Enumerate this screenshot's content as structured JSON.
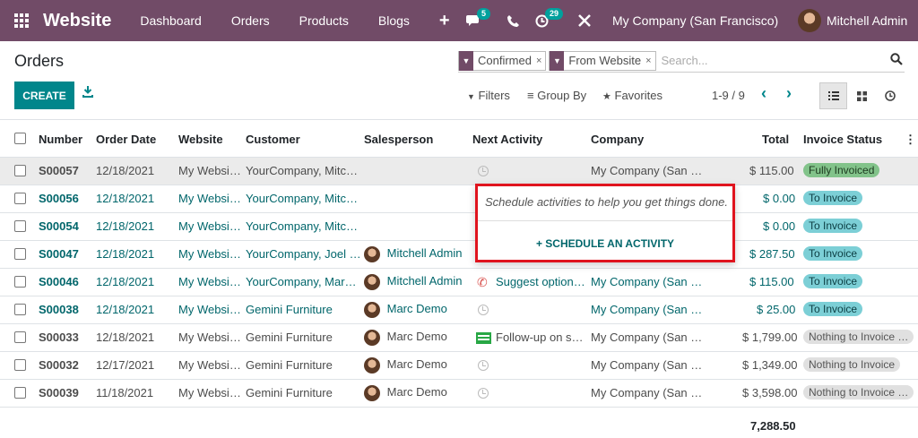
{
  "navbar": {
    "app_name": "Website",
    "menu": [
      "Dashboard",
      "Orders",
      "Products",
      "Blogs"
    ],
    "new_symbol": "+",
    "messages_badge": "5",
    "activities_badge": "29",
    "company": "My Company (San Francisco)",
    "user": "Mitchell Admin"
  },
  "page": {
    "title": "Orders"
  },
  "search": {
    "facets": [
      "Confirmed",
      "From Website"
    ],
    "facet_remove": "×",
    "placeholder": "Search..."
  },
  "controls": {
    "create": "CREATE",
    "filters": "Filters",
    "group_by": "Group By",
    "favorites": "Favorites",
    "pager": "1-9 / 9"
  },
  "table": {
    "headers": {
      "number": "Number",
      "order_date": "Order Date",
      "website": "Website",
      "customer": "Customer",
      "salesperson": "Salesperson",
      "next_activity": "Next Activity",
      "company": "Company",
      "total": "Total",
      "invoice_status": "Invoice Status"
    },
    "rows": [
      {
        "number": "S00057",
        "date": "12/18/2021",
        "website": "My Websi…",
        "customer": "YourCompany, Mitc…",
        "salesperson": "",
        "activity": "",
        "company": "My Company (San …",
        "total": "$ 115.00",
        "status": "Fully Invoiced"
      },
      {
        "number": "S00056",
        "date": "12/18/2021",
        "website": "My Websi…",
        "customer": "YourCompany, Mitc…",
        "salesperson": "",
        "activity": "",
        "company": "My Company (San …",
        "total": "$ 0.00",
        "status": "To Invoice"
      },
      {
        "number": "S00054",
        "date": "12/18/2021",
        "website": "My Websi…",
        "customer": "YourCompany, Mitc…",
        "salesperson": "",
        "activity": "",
        "company": "My Company (San …",
        "total": "$ 0.00",
        "status": "To Invoice"
      },
      {
        "number": "S00047",
        "date": "12/18/2021",
        "website": "My Websi…",
        "customer": "YourCompany, Joel …",
        "salesperson": "Mitchell Admin",
        "activity": "",
        "company": "My Company (San …",
        "total": "$ 287.50",
        "status": "To Invoice"
      },
      {
        "number": "S00046",
        "date": "12/18/2021",
        "website": "My Websi…",
        "customer": "YourCompany, Mar…",
        "salesperson": "Mitchell Admin",
        "activity": "Suggest option…",
        "company": "My Company (San …",
        "total": "$ 115.00",
        "status": "To Invoice"
      },
      {
        "number": "S00038",
        "date": "12/18/2021",
        "website": "My Websi…",
        "customer": "Gemini Furniture",
        "salesperson": "Marc Demo",
        "activity": "",
        "company": "My Company (San …",
        "total": "$ 25.00",
        "status": "To Invoice"
      },
      {
        "number": "S00033",
        "date": "12/18/2021",
        "website": "My Websi…",
        "customer": "Gemini Furniture",
        "salesperson": "Marc Demo",
        "activity": "Follow-up on s…",
        "company": "My Company (San …",
        "total": "$ 1,799.00",
        "status": "Nothing to Invoice …"
      },
      {
        "number": "S00032",
        "date": "12/17/2021",
        "website": "My Websi…",
        "customer": "Gemini Furniture",
        "salesperson": "Marc Demo",
        "activity": "",
        "company": "My Company (San …",
        "total": "$ 1,349.00",
        "status": "Nothing to Invoice"
      },
      {
        "number": "S00039",
        "date": "11/18/2021",
        "website": "My Websi…",
        "customer": "Gemini Furniture",
        "salesperson": "Marc Demo",
        "activity": "",
        "company": "My Company (San …",
        "total": "$ 3,598.00",
        "status": "Nothing to Invoice …"
      }
    ],
    "footer_total": "7,288.50"
  },
  "popover": {
    "message": "Schedule activities to help you get things done.",
    "button": "+ SCHEDULE AN ACTIVITY"
  },
  "colors": {
    "navbar": "#714b67",
    "primary": "#00868b",
    "highlight_border": "#e0141e"
  }
}
